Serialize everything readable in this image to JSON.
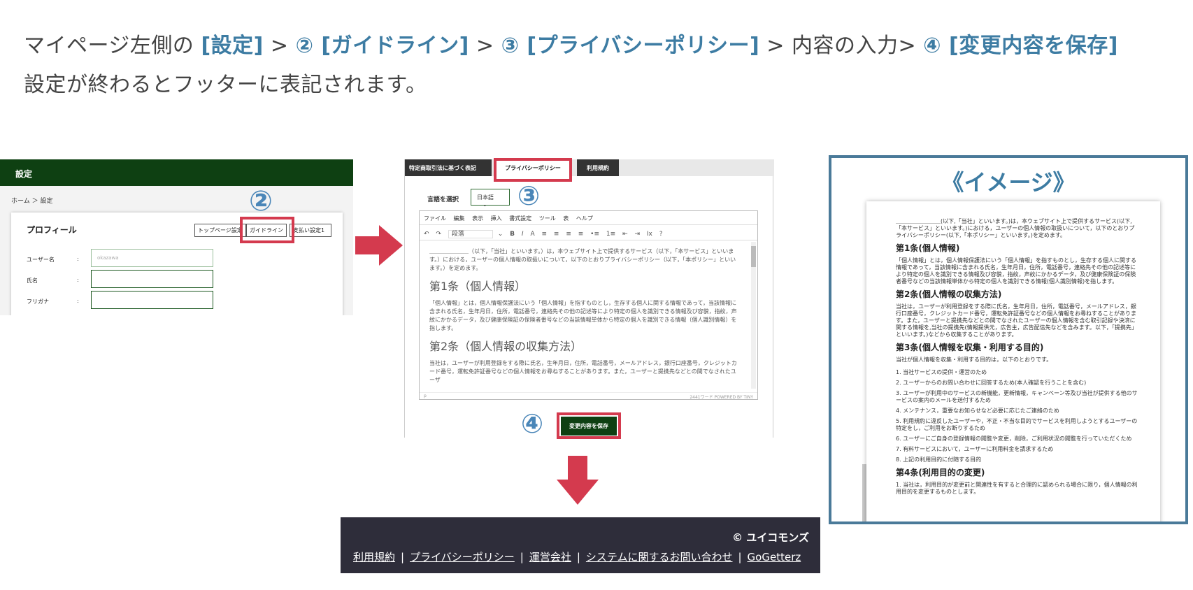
{
  "intro": {
    "line1_a": "マイページ左側の ",
    "line1_settings": "[設定]",
    "line1_b": " > ",
    "line1_n2": "② [ガイドライン]",
    "line1_c": " > ",
    "line1_n3": "③ [プライバシーポリシー]",
    "line1_d": " > 内容の入力> ",
    "line1_n4": "④ [変更内容を保存]",
    "line2": "設定が終わるとフッターに表記されます。"
  },
  "settings_panel": {
    "header": "設定",
    "breadcrumb": "ホーム ＞ 設定",
    "card_title": "プロフィール",
    "buttons": [
      "トップページ設定",
      "ガイドライン",
      "支払い設定1"
    ],
    "fields": [
      {
        "label": "ユーザー名",
        "colon": ":",
        "value": "okazawa"
      },
      {
        "label": "氏名",
        "colon": ":",
        "value": ""
      },
      {
        "label": "フリガナ",
        "colon": ":",
        "value": ""
      }
    ],
    "step_number": "②"
  },
  "editor_panel": {
    "tabs": [
      "特定商取引法に基づく表記",
      "プライバシーポリシー",
      "利用規約"
    ],
    "language_label": "言語を選択",
    "language_value": "日本語",
    "step3": "③",
    "menubar": [
      "ファイル",
      "編集",
      "表示",
      "挿入",
      "書式設定",
      "ツール",
      "表",
      "ヘルプ"
    ],
    "toolbar": [
      "↶",
      "↷",
      "段落",
      "⌄",
      "B",
      "I",
      "A",
      "≡",
      "≡",
      "≡",
      "≡",
      "•≡",
      "1≡",
      "⇤",
      "⇥",
      "Ix",
      "?"
    ],
    "body_intro": "＿＿＿＿＿＿＿（以下，「当社」といいます。）は，本ウェブサイト上で提供するサービス（以下，「本サービス」といいます。）における，ユーザーの個人情報の取扱いについて，以下のとおりプライバシーポリシー（以下，「本ポリシー」といいます。）を定めます。",
    "h1": "第1条（個人情報）",
    "p1": "「個人情報」とは，個人情報保護法にいう「個人情報」を指すものとし，生存する個人に関する情報であって，当該情報に含まれる氏名，生年月日，住所，電話番号，連絡先その他の記述等により特定の個人を識別できる情報及び容貌，指紋，声紋にかかるデータ，及び健康保険証の保険者番号などの当該情報単体から特定の個人を識別できる情報（個人識別情報）を指します。",
    "h2": "第2条（個人情報の収集方法）",
    "p2": "当社は，ユーザーが利用登録をする際に氏名，生年月日，住所，電話番号，メールアドレス，銀行口座番号，クレジットカード番号，運転免許証番号などの個人情報をお尋ねすることがあります。また，ユーザーと提携先などとの間でなされたユーザ",
    "status_left": "p",
    "status_right": "2441ワード POWERED BY TINY",
    "save_button": "変更内容を保存",
    "step4": "④"
  },
  "preview": {
    "title": "《イメージ》",
    "intro": "＿＿＿＿＿＿＿＿(以下,「当社」といいます。)は，本ウェブサイト上で提供するサービス(以下,「本サービス」といいます。)における，ユーザーの個人情報の取扱いについて，以下のとおりプライバシーポリシー(以下,「本ポリシー」といいます。)を定めます。",
    "h1": "第1条(個人情報)",
    "p1": "「個人情報」とは，個人情報保護法にいう「個人情報」を指すものとし，生存する個人に関する情報であって，当該情報に含まれる氏名，生年月日，住所，電話番号，連絡先その他の記述等により特定の個人を識別できる情報及び容貌，指紋，声紋にかかるデータ，及び健康保険証の保険者番号などの当該情報単体から特定の個人を識別できる情報(個人識別情報)を指します。",
    "h2": "第2条(個人情報の収集方法)",
    "p2": "当社は，ユーザーが利用登録をする際に氏名，生年月日，住所，電話番号，メールアドレス，銀行口座番号，クレジットカード番号，運転免許証番号などの個人情報をお尋ねすることがあります。また，ユーザーと提携先などとの間でなされたユーザーの個人情報を含む取引記録や決済に関する情報を,当社の提携先(情報提供元，広告主，広告配信先などを含みます。以下，｢提携先｣といいます。)などから収集することがあります。",
    "h3": "第3条(個人情報を収集・利用する目的)",
    "p3": "当社が個人情報を収集・利用する目的は，以下のとおりです。",
    "list": [
      "1. 当社サービスの提供・運営のため",
      "2. ユーザーからのお問い合わせに回答するため(本人確認を行うことを含む)",
      "3. ユーザーが利用中のサービスの新機能，更新情報，キャンペーン等及び当社が提供する他のサービスの案内のメールを送付するため",
      "4. メンテナンス，重要なお知らせなど必要に応じたご連絡のため",
      "5. 利用規約に違反したユーザーや，不正・不当な目的でサービスを利用しようとするユーザーの特定をし，ご利用をお断りするため",
      "6. ユーザーにご自身の登録情報の閲覧や変更，削除，ご利用状況の閲覧を行っていただくため",
      "7. 有料サービスにおいて，ユーザーに利用料金を請求するため",
      "8. 上記の利用目的に付随する目的"
    ],
    "h4": "第4条(利用目的の変更)",
    "p4": "1. 当社は，利用目的が変更前と関連性を有すると合理的に認められる場合に限り，個人情報の利用目的を変更するものとします。"
  },
  "footer": {
    "copyright": "© ユイコモンズ",
    "links": [
      "利用規約",
      "プライバシーポリシー",
      "運営会社",
      "システムに関するお問い合わせ",
      "GoGetterz"
    ],
    "separator": "|"
  },
  "colors": {
    "accent": "#3d7ca3",
    "red": "#d43a4e",
    "dark_green": "#0e4012",
    "footer_bg": "#2e2d3a"
  }
}
